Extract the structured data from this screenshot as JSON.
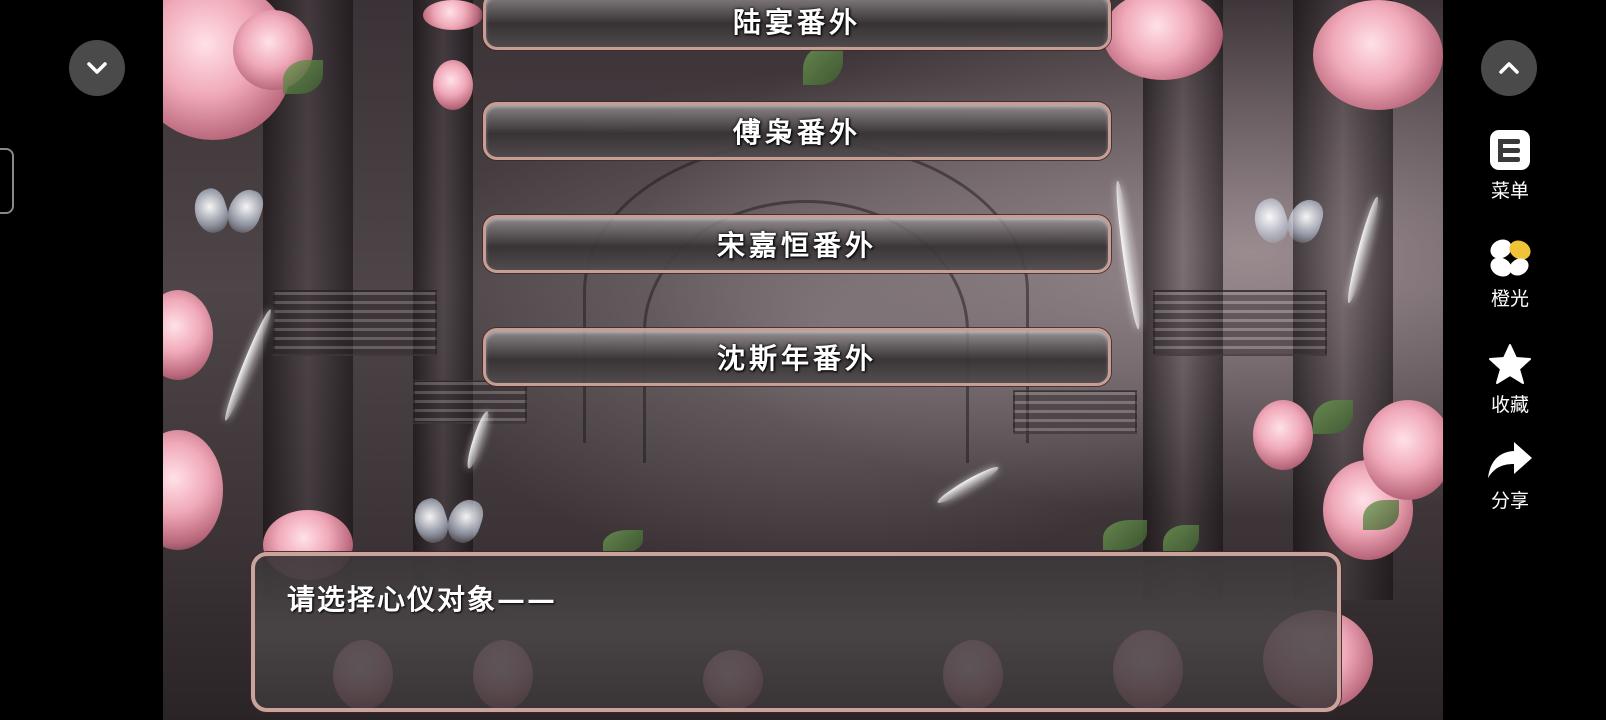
{
  "choices": [
    {
      "label": "陆宴番外"
    },
    {
      "label": "傅枭番外"
    },
    {
      "label": "宋嘉恒番外"
    },
    {
      "label": "沈斯年番外"
    }
  ],
  "dialog": {
    "text": "请选择心仪对象——"
  },
  "side_menu": {
    "collapse_icon": "chevron-down-icon",
    "expand_icon": "chevron-up-icon",
    "items": [
      {
        "label": "菜单",
        "icon": "menu-icon"
      },
      {
        "label": "橙光",
        "icon": "orange-light-icon"
      },
      {
        "label": "收藏",
        "icon": "star-icon"
      },
      {
        "label": "分享",
        "icon": "share-icon"
      }
    ]
  },
  "colors": {
    "button_border": "#c79d94",
    "side_circle": "#4a4a4a",
    "text": "#ffffff"
  }
}
